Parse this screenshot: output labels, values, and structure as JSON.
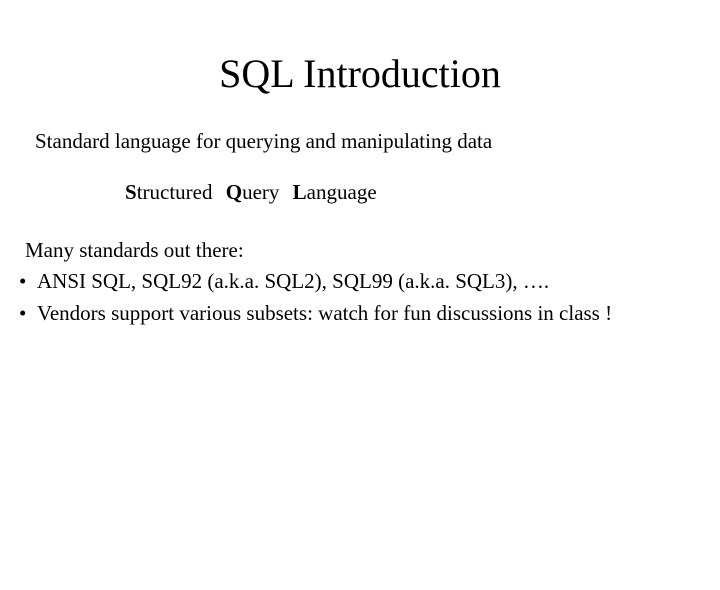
{
  "title": "SQL Introduction",
  "subtitle": "Standard language for querying and manipulating data",
  "acronym": {
    "s_bold": "S",
    "s_rest": "tructured",
    "q_bold": "Q",
    "q_rest": "uery",
    "l_bold": "L",
    "l_rest": "anguage"
  },
  "standards_intro": "Many standards out there:",
  "bullets": [
    "ANSI SQL,  SQL92 (a.k.a. SQL2),  SQL99 (a.k.a. SQL3), ….",
    "Vendors support various subsets: watch for fun discussions in class !"
  ]
}
